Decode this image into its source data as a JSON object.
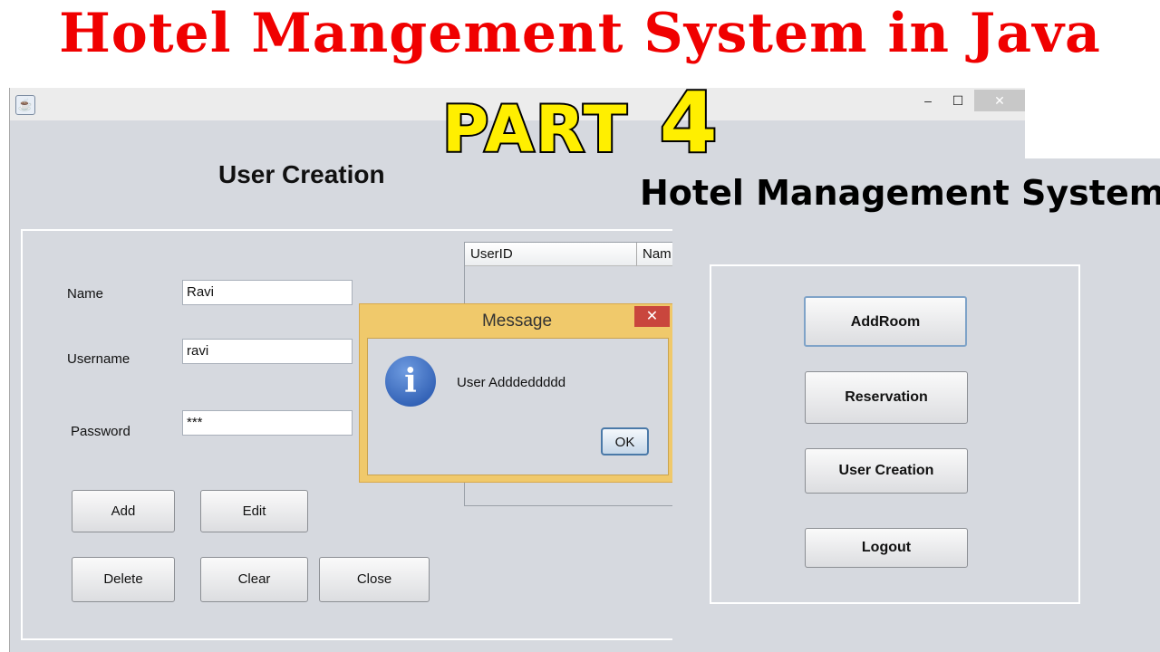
{
  "headline": "Hotel Mangement System in Java",
  "overlay": {
    "part_word": "PART",
    "part_number": "4"
  },
  "user_window": {
    "window_controls": {
      "minimize": "–",
      "maximize": "☐",
      "close": "✕"
    },
    "title": "User Creation",
    "form": {
      "name_label": "Name",
      "name_value": "Ravi",
      "username_label": "Username",
      "username_value": "ravi",
      "password_label": "Password",
      "password_value": "***"
    },
    "buttons": {
      "add": "Add",
      "edit": "Edit",
      "delete": "Delete",
      "clear": "Clear",
      "close": "Close"
    },
    "table": {
      "columns": [
        "UserID",
        "Nam"
      ]
    }
  },
  "dialog": {
    "title": "Message",
    "close": "✕",
    "message": "User Adddeddddd",
    "ok": "OK",
    "icon": "information-icon"
  },
  "main_menu": {
    "title": "Hotel Management System",
    "buttons": [
      "AddRoom",
      "Reservation",
      "User Creation",
      "Logout"
    ]
  },
  "colors": {
    "headline": "#f00000",
    "overlay": "#ffef00",
    "dialog_frame": "#f0c96b",
    "window_bg": "#d6d9df"
  }
}
